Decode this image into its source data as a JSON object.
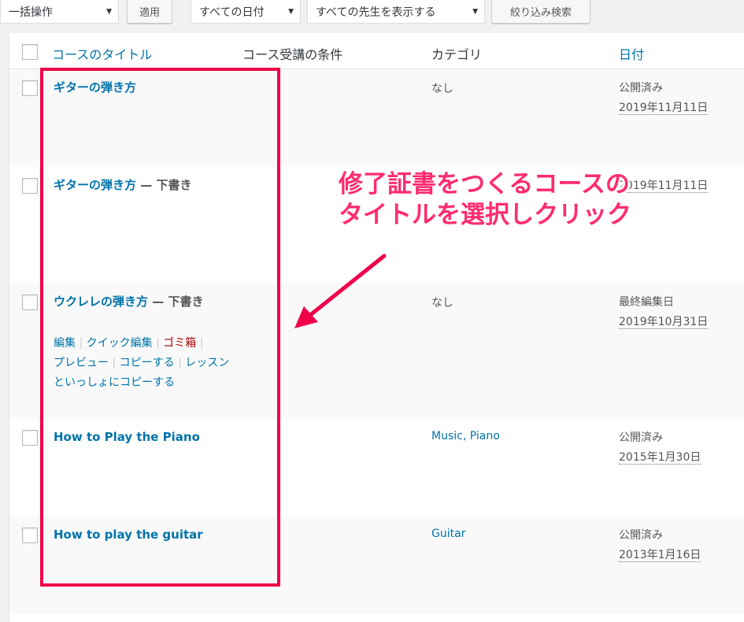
{
  "toolbar": {
    "bulk_action": "一括操作",
    "apply": "適用",
    "date_filter": "すべての日付",
    "teacher_filter": "すべての先生を表示する",
    "filter_button": "絞り込み検索"
  },
  "table": {
    "headers": {
      "title": "コースのタイトル",
      "prerequisite": "コース受講の条件",
      "category": "カテゴリ",
      "date": "日付"
    },
    "rows": [
      {
        "title": "ギターの弾き方",
        "state": "",
        "category": "なし",
        "date_status": "公開済み",
        "date": "2019年11月11日"
      },
      {
        "title": "ギターの弾き方",
        "state": " — 下書き",
        "category": "",
        "date_status": "",
        "date": "2019年11月11日"
      },
      {
        "title": "ウクレレの弾き方",
        "state": " — 下書き",
        "category": "なし",
        "date_status": "最終編集日",
        "date": "2019年10月31日",
        "actions": {
          "edit": "編集",
          "quick_edit": "クイック編集",
          "trash": "ゴミ箱",
          "preview": "プレビュー",
          "copy": "コピーする",
          "copy_with_lessons": "レッスンといっしょにコピーする"
        }
      },
      {
        "title": "How to Play the Piano",
        "state": "",
        "category": "Music, Piano",
        "date_status": "公開済み",
        "date": "2015年1月30日"
      },
      {
        "title": "How to play the guitar",
        "state": "",
        "category": "Guitar",
        "date_status": "公開済み",
        "date": "2013年1月16日"
      }
    ]
  },
  "annotation": {
    "line1": "修了証書をつくるコースの",
    "line2": "タイトルを選択しクリック",
    "color": "#ff2b6e",
    "box_color": "#f0004a"
  }
}
